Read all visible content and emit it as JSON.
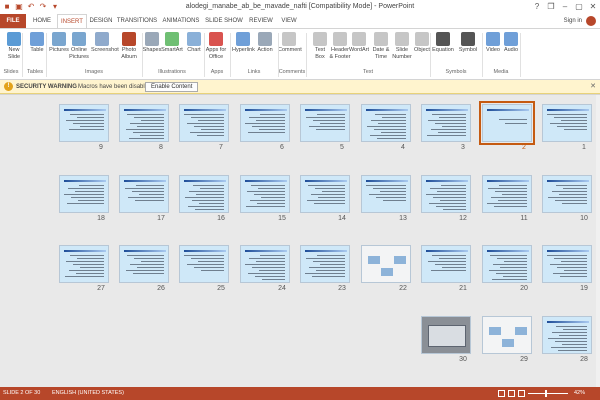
{
  "titlebar": {
    "title": "alodegi_manabe_ab_be_mavade_nafti [Compatibility Mode] - PowerPoint",
    "qat_icons": [
      "powerpoint-logo",
      "save-icon",
      "undo-icon",
      "redo-icon",
      "customize-icon"
    ],
    "window_controls": [
      "?",
      "❐",
      "–",
      "▢",
      "✕"
    ]
  },
  "tabs": [
    "FILE",
    "HOME",
    "INSERT",
    "DESIGN",
    "TRANSITIONS",
    "ANIMATIONS",
    "SLIDE SHOW",
    "REVIEW",
    "VIEW"
  ],
  "active_tab": "INSERT",
  "signin": "Sign in",
  "ribbon": {
    "buttons": [
      {
        "label": "New\nSlide",
        "color": "#5b9bd5"
      },
      {
        "label": "Table",
        "color": "#6f9fd8"
      },
      {
        "label": "Pictures",
        "color": "#7aa6cf"
      },
      {
        "label": "Online\nPictures",
        "color": "#7aa6cf"
      },
      {
        "label": "Screenshot",
        "color": "#8faacc"
      },
      {
        "label": "Photo\nAlbum",
        "color": "#b7472a"
      },
      {
        "label": "Shapes",
        "color": "#9aa8b8"
      },
      {
        "label": "SmartArt",
        "color": "#6fbf73"
      },
      {
        "label": "Chart",
        "color": "#8ab0d8"
      },
      {
        "label": "Apps for\nOffice",
        "color": "#d9534f"
      },
      {
        "label": "Hyperlink",
        "color": "#6f9fd8"
      },
      {
        "label": "Action",
        "color": "#9aa8b8"
      },
      {
        "label": "Comment",
        "color": "#c6c6c6"
      },
      {
        "label": "Text\nBox",
        "color": "#c6c6c6"
      },
      {
        "label": "Header\n& Footer",
        "color": "#c6c6c6"
      },
      {
        "label": "WordArt",
        "color": "#c6c6c6"
      },
      {
        "label": "Date &\nTime",
        "color": "#c6c6c6"
      },
      {
        "label": "Slide\nNumber",
        "color": "#c6c6c6"
      },
      {
        "label": "Object",
        "color": "#c6c6c6"
      },
      {
        "label": "Equation",
        "color": "#555555"
      },
      {
        "label": "Symbol",
        "color": "#555555"
      },
      {
        "label": "Video",
        "color": "#6f9fd8"
      },
      {
        "label": "Audio",
        "color": "#6f9fd8"
      }
    ],
    "groups": [
      "Slides",
      "Tables",
      "Images",
      "Illustrations",
      "Apps",
      "Links",
      "Comments",
      "Text",
      "Symbols",
      "Media"
    ]
  },
  "security": {
    "icon": "!",
    "warning": "SECURITY WARNING",
    "message": "Macros have been disabled.",
    "button": "Enable Content",
    "close": "✕"
  },
  "slides": [
    {
      "number": "1",
      "type": "text",
      "selected": false
    },
    {
      "number": "2",
      "type": "title",
      "selected": true
    },
    {
      "number": "3",
      "type": "text",
      "selected": false
    },
    {
      "number": "4",
      "type": "text",
      "selected": false
    },
    {
      "number": "5",
      "type": "text",
      "selected": false
    },
    {
      "number": "6",
      "type": "text",
      "selected": false
    },
    {
      "number": "7",
      "type": "text",
      "selected": false
    },
    {
      "number": "8",
      "type": "text",
      "selected": false
    },
    {
      "number": "9",
      "type": "text",
      "selected": false
    },
    {
      "number": "10",
      "type": "text",
      "selected": false
    },
    {
      "number": "11",
      "type": "text",
      "selected": false
    },
    {
      "number": "12",
      "type": "text",
      "selected": false
    },
    {
      "number": "13",
      "type": "text",
      "selected": false
    },
    {
      "number": "14",
      "type": "text",
      "selected": false
    },
    {
      "number": "15",
      "type": "text",
      "selected": false
    },
    {
      "number": "16",
      "type": "text",
      "selected": false
    },
    {
      "number": "17",
      "type": "text",
      "selected": false
    },
    {
      "number": "18",
      "type": "text",
      "selected": false
    },
    {
      "number": "19",
      "type": "text",
      "selected": false
    },
    {
      "number": "20",
      "type": "text",
      "selected": false
    },
    {
      "number": "21",
      "type": "text",
      "selected": false
    },
    {
      "number": "22",
      "type": "diagram",
      "selected": false
    },
    {
      "number": "23",
      "type": "text",
      "selected": false
    },
    {
      "number": "24",
      "type": "text",
      "selected": false
    },
    {
      "number": "25",
      "type": "text",
      "selected": false
    },
    {
      "number": "26",
      "type": "text",
      "selected": false
    },
    {
      "number": "27",
      "type": "text",
      "selected": false
    },
    {
      "number": "28",
      "type": "text",
      "selected": false
    },
    {
      "number": "29",
      "type": "diagram",
      "selected": false
    },
    {
      "number": "30",
      "type": "photo",
      "selected": false
    }
  ],
  "statusbar": {
    "slide_indicator": "SLIDE 2 OF 30",
    "language": "ENGLISH (UNITED STATES)",
    "zoom": "42%",
    "zoom_fraction": 0.42
  }
}
